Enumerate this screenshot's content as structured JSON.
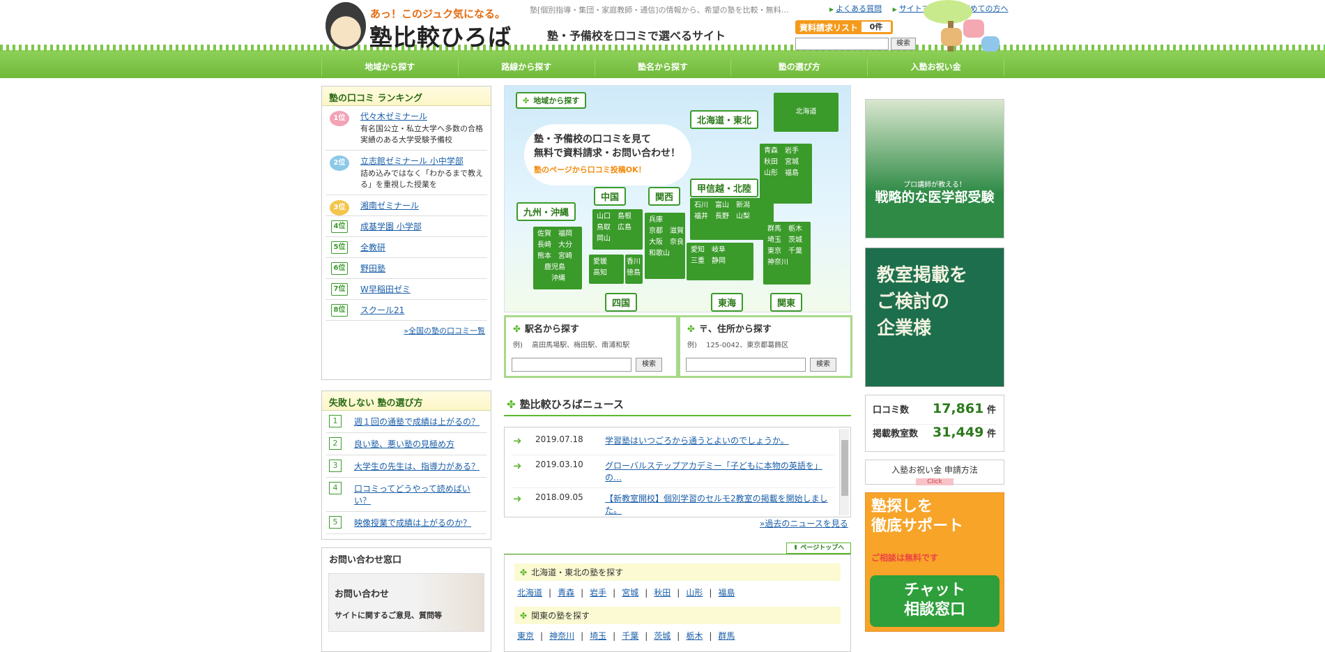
{
  "header": {
    "tagline": "あっ！このジュク気になる。",
    "site_name": "塾比較ひろば",
    "catch": "塾[個別指導・集団・家庭教師・通信]の情報から、希望の塾を比較・無料…",
    "slogan": "塾・予備校を口コミで選べるサイト",
    "toplinks": [
      "よくある質問",
      "サイトマップ",
      "初めての方へ"
    ],
    "request_list_label": "資料請求リスト",
    "request_count": "0件",
    "search_button": "検索"
  },
  "nav": [
    "地域から探す",
    "路線から探す",
    "塾名から探す",
    "塾の選び方",
    "入塾お祝い金"
  ],
  "ranking": {
    "title": "塾の口コミ ランキング",
    "items": [
      {
        "rank": "1位",
        "name": "代々木ゼミナール",
        "desc": "有名国公立・私立大学へ多数の合格実績のある大学受験予備校"
      },
      {
        "rank": "2位",
        "name": "立志館ゼミナール 小中学部",
        "desc": "詰め込みではなく「わかるまで教える」を重視した授業を"
      },
      {
        "rank": "3位",
        "name": "湘南ゼミナール",
        "desc": ""
      },
      {
        "rank": "4位",
        "name": "成基学園 小学部",
        "desc": ""
      },
      {
        "rank": "5位",
        "name": "全教研",
        "desc": ""
      },
      {
        "rank": "6位",
        "name": "野田塾",
        "desc": ""
      },
      {
        "rank": "7位",
        "name": "W早稲田ゼミ",
        "desc": ""
      },
      {
        "rank": "8位",
        "name": "スクール21",
        "desc": ""
      }
    ],
    "more": "»全国の塾の口コミ一覧"
  },
  "choose": {
    "title": "失敗しない 塾の選び方",
    "items": [
      "週１回の通塾で成績は上がるの？",
      "良い塾、悪い塾の見極め方",
      "大学生の先生は、指導力がある？",
      "口コミってどうやって読めばいい？",
      "映像授業で成績は上がるのか？"
    ]
  },
  "inquiry": {
    "title": "お問い合わせ窓口",
    "link": "お問い合わせ",
    "desc": "サイトに関するご意見、質問等"
  },
  "map": {
    "badge": "地域から探す",
    "bubble_line1": "塾・予備校の口コミを見て",
    "bubble_line2": "無料で資料請求・お問い合わせ！",
    "bubble_note": "塾のページから口コミ投稿OK！",
    "regions": [
      "北海道・東北",
      "甲信越・北陸",
      "九州・沖縄",
      "中国",
      "関西",
      "四国",
      "東海",
      "関東"
    ],
    "prefs": {
      "hokkaido": "北海道",
      "tohoku": "青森　岩手\n秋田　宮城\n山形　福島",
      "hokuriku": "石川　富山　新潟\n福井　長野　山梨",
      "kyushu": "佐賀　福岡\n長崎　大分\n熊本　宮崎\n　鹿児島\n　　沖縄",
      "chugoku": "山口　島根\n鳥取　広島\n岡山",
      "kansai": "兵庫\n京都　滋賀\n大阪　奈良\n和歌山",
      "shikoku1": "愛媛\n高知",
      "shikoku2": "香川\n徳島",
      "tokai": "愛知　岐阜\n三重　静岡",
      "kanto": "群馬　栃木\n埼玉　茨城\n東京　千葉\n神奈川"
    }
  },
  "station": {
    "title": "駅名から探す",
    "example": "例)　 高田馬場駅、梅田駅、南浦和駅",
    "button": "検索"
  },
  "address": {
    "title": "〒、住所から探す",
    "example": "例)　 125-0042、東京都葛飾区",
    "button": "検索"
  },
  "news": {
    "title": "塾比較ひろばニュース",
    "items": [
      {
        "date": "2019.07.18",
        "text": "学習塾はいつごろから通うとよいのでしょうか。"
      },
      {
        "date": "2019.03.10",
        "text": "グローバルステップアカデミー「子どもに本物の英語を」の…"
      },
      {
        "date": "2018.09.05",
        "text": "【新教室開校】個別学習のセルモ2教室の掲載を開始しました。"
      }
    ],
    "more": "»過去のニュースを見る"
  },
  "pagetop": "ページトップへ",
  "regions_list": [
    {
      "title": "北海道・東北の塾を探す",
      "links": [
        "北海道",
        "青森",
        "岩手",
        "宮城",
        "秋田",
        "山形",
        "福島"
      ]
    },
    {
      "title": "関東の塾を探す",
      "links": [
        "東京",
        "神奈川",
        "埼玉",
        "千葉",
        "茨城",
        "栃木",
        "群馬"
      ]
    }
  ],
  "ads": {
    "ad1_small": "プロ講師が教える！",
    "ad1_title": "戦略的な医学部受験",
    "ad2_text": "教室掲載を\nご検討の\n企業様",
    "ad3_title": "塾探しを\n徹底サポート",
    "ad3_sub": "ご相談は無料です",
    "ad3_chat": "チャット\n相談窓口"
  },
  "stats": [
    {
      "label": "口コミ数",
      "value": "17,861",
      "unit": "件"
    },
    {
      "label": "掲載教室数",
      "value": "31,449",
      "unit": "件"
    }
  ],
  "celebration": {
    "label": "入塾お祝い金 申請方法",
    "click": "Click"
  }
}
